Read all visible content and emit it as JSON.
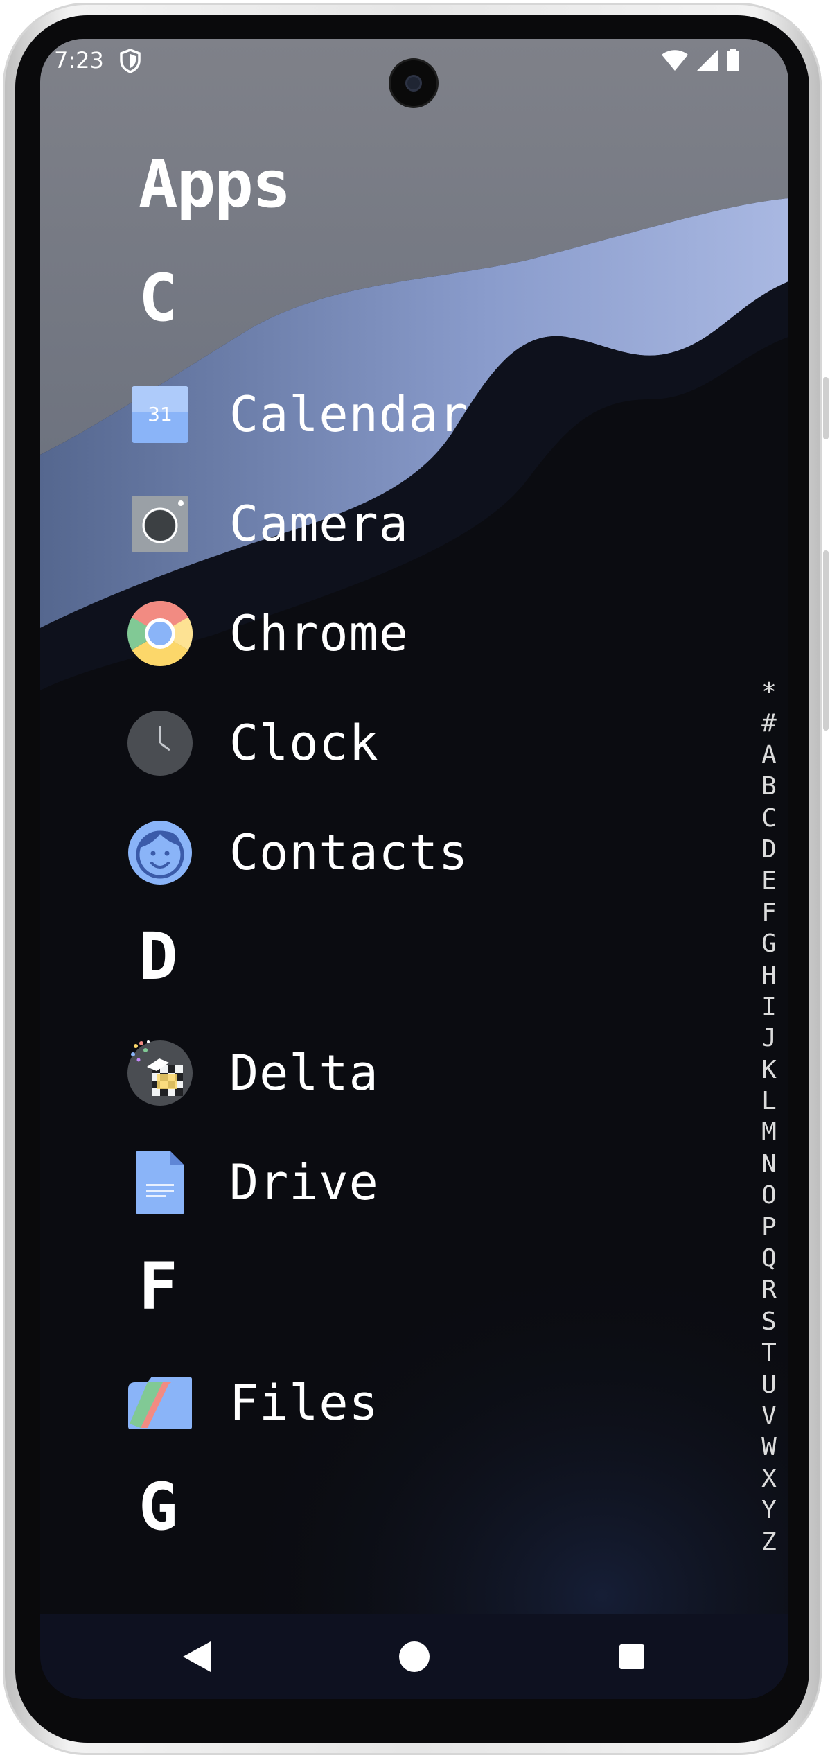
{
  "status_bar": {
    "time": "7:23",
    "icons": [
      "shield-icon",
      "wifi-icon",
      "cellular-signal-icon",
      "battery-icon"
    ]
  },
  "drawer": {
    "title": "Apps",
    "sections": [
      {
        "letter": "C",
        "apps": [
          {
            "label": "Calendar",
            "icon": "calendar-icon",
            "icon_text": "31"
          },
          {
            "label": "Camera",
            "icon": "camera-icon"
          },
          {
            "label": "Chrome",
            "icon": "chrome-icon"
          },
          {
            "label": "Clock",
            "icon": "clock-icon"
          },
          {
            "label": "Contacts",
            "icon": "contacts-icon"
          }
        ]
      },
      {
        "letter": "D",
        "apps": [
          {
            "label": "Delta",
            "icon": "delta-icon"
          },
          {
            "label": "Drive",
            "icon": "drive-icon"
          }
        ]
      },
      {
        "letter": "F",
        "apps": [
          {
            "label": "Files",
            "icon": "files-icon"
          }
        ]
      },
      {
        "letter": "G",
        "apps": []
      }
    ]
  },
  "alphabet_index": [
    "*",
    "#",
    "A",
    "B",
    "C",
    "D",
    "E",
    "F",
    "G",
    "H",
    "I",
    "J",
    "K",
    "L",
    "M",
    "N",
    "O",
    "P",
    "Q",
    "R",
    "S",
    "T",
    "U",
    "V",
    "W",
    "X",
    "Y",
    "Z"
  ],
  "navigation_bar": {
    "buttons": [
      "back-icon",
      "home-icon",
      "recents-icon"
    ]
  },
  "colors": {
    "background": "#0b0c11",
    "text": "#ffffff",
    "index_text": "#dcdcdc",
    "nav_bar": "#0e1120"
  }
}
